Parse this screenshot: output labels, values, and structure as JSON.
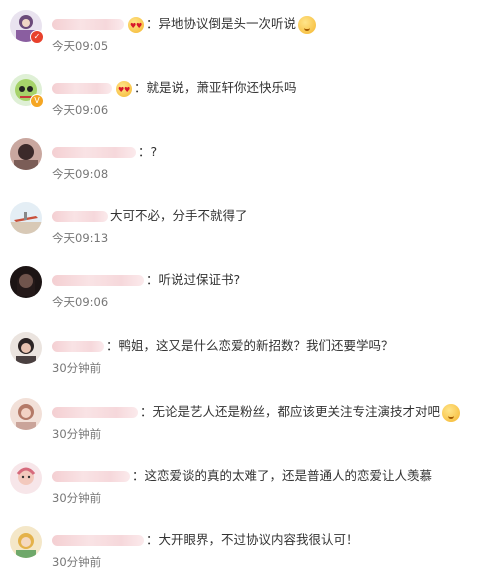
{
  "comments": [
    {
      "text": "异地协议倒是头一次听说",
      "time": "今天09:05"
    },
    {
      "text": "就是说，萧亚轩你还快乐吗",
      "time": "今天09:06"
    },
    {
      "text": "?",
      "time": "今天09:08"
    },
    {
      "text": "大可不必，分手不就得了",
      "time": "今天09:13"
    },
    {
      "text": "听说过保证书?",
      "time": "今天09:06"
    },
    {
      "text": "鸭姐，这又是什么恋爱的新招数？我们还要学吗？",
      "time": "30分钟前"
    },
    {
      "text": "无论是艺人还是粉丝，都应该更关注专注演技才对吧",
      "time": "30分钟前"
    },
    {
      "text": "这恋爱谈的真的太难了，还是普通人的恋爱让人羡慕",
      "time": "30分钟前"
    },
    {
      "text": "大开眼界，不过协议内容我很认可！",
      "time": "30分钟前"
    }
  ],
  "icons": {
    "verified_badge": "v-badge-icon",
    "emoji_heart": "heart-eyes-emoji-icon",
    "emoji_smile": "smile-emoji-icon"
  }
}
